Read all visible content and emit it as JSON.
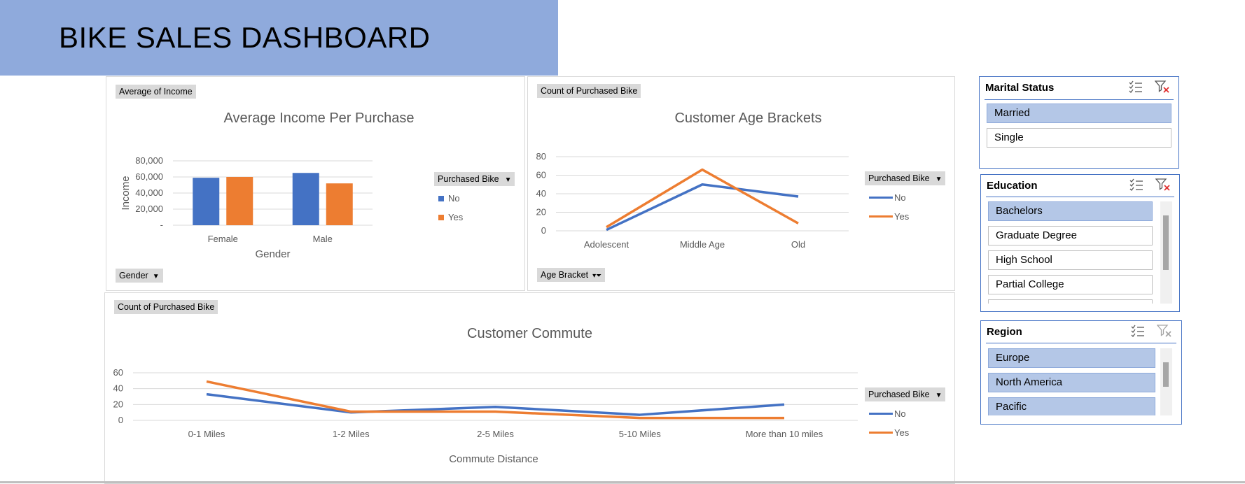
{
  "dashboard": {
    "title": "BIKE SALES DASHBOARD"
  },
  "colors": {
    "no": "#4472c4",
    "yes": "#ed7d31",
    "banner": "#8faadc",
    "grid": "#d9d9d9"
  },
  "income_chart": {
    "value_field": "Average of Income",
    "axis_field": "Gender",
    "legend_title": "Purchased Bike",
    "legend": [
      "No",
      "Yes"
    ],
    "yticks": [
      "-",
      "20,000",
      "40,000",
      "60,000",
      "80,000"
    ]
  },
  "age_chart": {
    "value_field": "Count of Purchased Bike",
    "axis_field": "Age Bracket",
    "legend_title": "Purchased Bike",
    "legend": [
      "No",
      "Yes"
    ],
    "yticks": [
      "0",
      "20",
      "40",
      "60",
      "80"
    ]
  },
  "commute_chart": {
    "value_field": "Count of Purchased Bike",
    "legend_title": "Purchased Bike",
    "legend": [
      "No",
      "Yes"
    ],
    "yticks": [
      "0",
      "20",
      "40",
      "60"
    ]
  },
  "slicers": {
    "marital": {
      "title": "Marital Status",
      "items": [
        "Married",
        "Single"
      ],
      "selected": [
        "Married"
      ]
    },
    "education": {
      "title": "Education",
      "items": [
        "Bachelors",
        "Graduate Degree",
        "High School",
        "Partial College"
      ],
      "selected": [
        "Bachelors"
      ]
    },
    "region": {
      "title": "Region",
      "items": [
        "Europe",
        "North America",
        "Pacific"
      ],
      "selected": [
        "Europe",
        "North America",
        "Pacific"
      ]
    }
  },
  "chart_data": [
    {
      "type": "bar",
      "title": "Average Income Per Purchase",
      "xlabel": "Gender",
      "ylabel": "Income",
      "categories": [
        "Female",
        "Male"
      ],
      "series": [
        {
          "name": "No",
          "values": [
            59000,
            65000
          ]
        },
        {
          "name": "Yes",
          "values": [
            60000,
            52000
          ]
        }
      ],
      "ylim": [
        0,
        80000
      ],
      "legend_position": "right"
    },
    {
      "type": "line",
      "title": "Customer Age Brackets",
      "xlabel": "Age Bracket",
      "ylabel": "",
      "categories": [
        "Adolescent",
        "Middle Age",
        "Old"
      ],
      "series": [
        {
          "name": "No",
          "values": [
            1,
            50,
            37
          ]
        },
        {
          "name": "Yes",
          "values": [
            4,
            66,
            8
          ]
        }
      ],
      "ylim": [
        0,
        80
      ],
      "legend_position": "right"
    },
    {
      "type": "line",
      "title": "Customer Commute",
      "xlabel": "Commute Distance",
      "ylabel": "",
      "categories": [
        "0-1 Miles",
        "1-2 Miles",
        "2-5 Miles",
        "5-10 Miles",
        "More than 10 miles"
      ],
      "series": [
        {
          "name": "No",
          "values": [
            33,
            10,
            17,
            7,
            20
          ]
        },
        {
          "name": "Yes",
          "values": [
            49,
            11,
            11,
            3,
            3
          ]
        }
      ],
      "ylim": [
        0,
        60
      ],
      "legend_position": "right"
    }
  ]
}
